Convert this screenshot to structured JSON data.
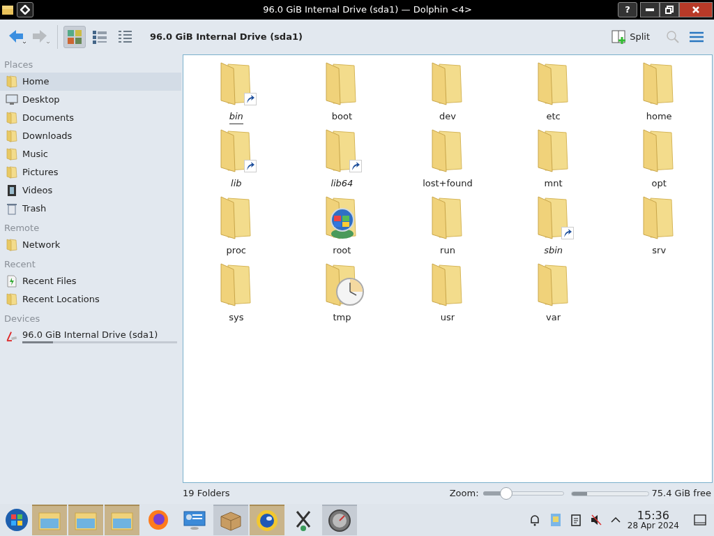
{
  "window": {
    "title": "96.0 GiB Internal Drive (sda1) — Dolphin <4>",
    "buttons": [
      "?"
    ]
  },
  "toolbar": {
    "view_modes": [
      {
        "kind": "icons",
        "selected": true
      },
      {
        "kind": "compact",
        "selected": false
      },
      {
        "kind": "details",
        "selected": false
      }
    ],
    "location": "96.0 GiB Internal Drive (sda1)",
    "split": "Split"
  },
  "sidebar": {
    "sections": [
      {
        "title": "Places",
        "items": [
          {
            "label": "Home",
            "kind": "folder",
            "selected": true
          },
          {
            "label": "Desktop",
            "kind": "desktop",
            "selected": false
          },
          {
            "label": "Documents",
            "kind": "folder",
            "selected": false
          },
          {
            "label": "Downloads",
            "kind": "folder",
            "selected": false
          },
          {
            "label": "Music",
            "kind": "folder",
            "selected": false
          },
          {
            "label": "Pictures",
            "kind": "folder",
            "selected": false
          },
          {
            "label": "Videos",
            "kind": "film",
            "selected": false
          },
          {
            "label": "Trash",
            "kind": "trash",
            "selected": false
          }
        ]
      },
      {
        "title": "Remote",
        "items": [
          {
            "label": "Network",
            "kind": "folder",
            "selected": false
          }
        ]
      },
      {
        "title": "Recent",
        "items": [
          {
            "label": "Recent Files",
            "kind": "document",
            "selected": false
          },
          {
            "label": "Recent Locations",
            "kind": "folder",
            "selected": false
          }
        ]
      },
      {
        "title": "Devices",
        "items": [
          {
            "label": "96.0 GiB Internal Drive (sda1)",
            "kind": "drive",
            "selected": false,
            "level": 0.2
          }
        ]
      }
    ]
  },
  "files": [
    {
      "name": "bin",
      "kind": "link",
      "selected": true
    },
    {
      "name": "boot",
      "kind": "folder",
      "selected": false
    },
    {
      "name": "dev",
      "kind": "folder",
      "selected": false
    },
    {
      "name": "etc",
      "kind": "folder",
      "selected": false
    },
    {
      "name": "home",
      "kind": "folder",
      "selected": false
    },
    {
      "name": "lib",
      "kind": "link",
      "selected": false
    },
    {
      "name": "lib64",
      "kind": "link",
      "selected": false
    },
    {
      "name": "lost+found",
      "kind": "folder",
      "selected": false
    },
    {
      "name": "mnt",
      "kind": "folder",
      "selected": false
    },
    {
      "name": "opt",
      "kind": "folder",
      "selected": false
    },
    {
      "name": "proc",
      "kind": "folder",
      "selected": false
    },
    {
      "name": "root",
      "kind": "globe",
      "selected": false
    },
    {
      "name": "run",
      "kind": "folder",
      "selected": false
    },
    {
      "name": "sbin",
      "kind": "link",
      "selected": false
    },
    {
      "name": "srv",
      "kind": "folder",
      "selected": false
    },
    {
      "name": "sys",
      "kind": "folder",
      "selected": false
    },
    {
      "name": "tmp",
      "kind": "clock",
      "selected": false
    },
    {
      "name": "usr",
      "kind": "folder",
      "selected": false
    },
    {
      "name": "var",
      "kind": "folder",
      "selected": false
    }
  ],
  "status_bar": {
    "count": "19 Folders",
    "zoom_label": "Zoom:",
    "zoom": {
      "level": 0.29
    },
    "free": {
      "level": 0.2
    },
    "free_text": "75.4 GiB free"
  },
  "taskbar": {
    "tasks": [
      {
        "kind": "folder",
        "open": true,
        "minimized": false
      },
      {
        "kind": "folder",
        "open": true,
        "minimized": false
      },
      {
        "kind": "folder",
        "open": true,
        "minimized": false
      },
      {
        "kind": "browser",
        "open": false,
        "minimized": false
      },
      {
        "kind": "monitor",
        "open": false,
        "minimized": false
      },
      {
        "kind": "package",
        "open": false,
        "minimized": true
      },
      {
        "kind": "globe",
        "open": true,
        "minimized": false
      },
      {
        "kind": "tool",
        "open": false,
        "minimized": false
      },
      {
        "kind": "gauge",
        "open": false,
        "minimized": true
      }
    ],
    "time": "15:36",
    "date": "28 Apr 2024"
  }
}
